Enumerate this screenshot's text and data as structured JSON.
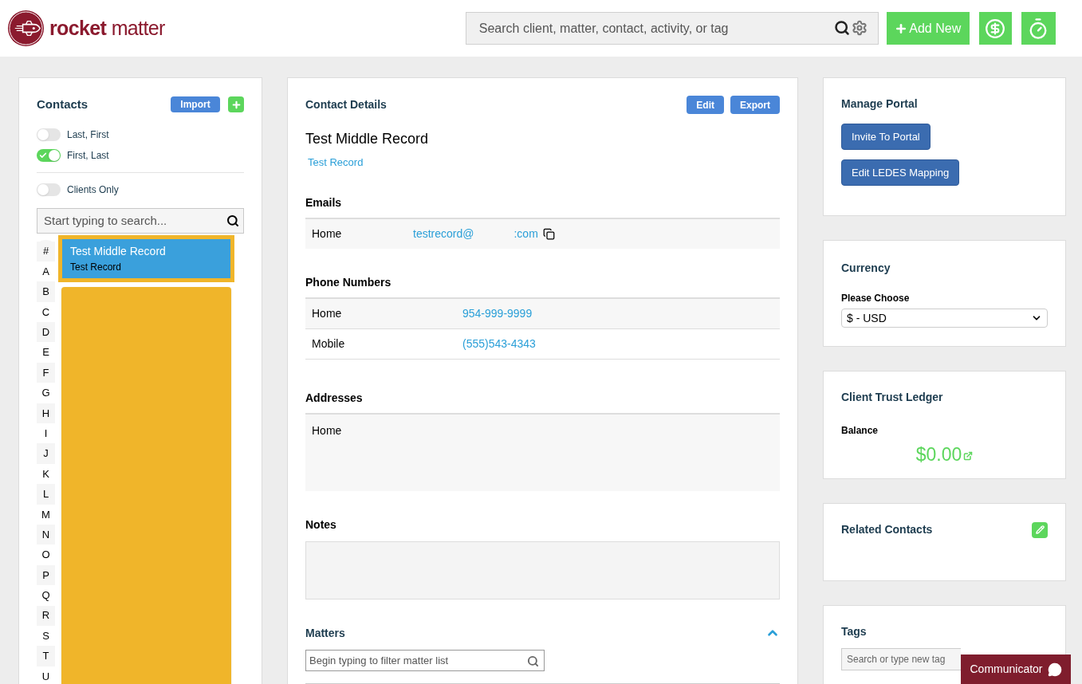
{
  "header": {
    "logo": {
      "bold": "rocket",
      "light": "matter"
    },
    "search": {
      "placeholder": "Search client, matter, contact, activity, or tag"
    },
    "add_button": "Add New"
  },
  "contacts": {
    "title": "Contacts",
    "import_button": "Import",
    "toggles": [
      {
        "label": "Last, First",
        "on": false
      },
      {
        "label": "First, Last",
        "on": true
      }
    ],
    "clients_only": {
      "label": "Clients Only",
      "on": false
    },
    "search": {
      "placeholder": "Start typing to search..."
    },
    "letters": [
      "#",
      "A",
      "B",
      "C",
      "D",
      "E",
      "F",
      "G",
      "H",
      "I",
      "J",
      "K",
      "L",
      "M",
      "N",
      "O",
      "P",
      "Q",
      "R",
      "S",
      "T",
      "U"
    ],
    "items": [
      {
        "name": "Test Middle Record",
        "sub": "Test Record",
        "selected": true
      }
    ]
  },
  "details": {
    "title": "Contact Details",
    "buttons": [
      "Edit",
      "Export"
    ],
    "name": "Test Middle Record",
    "link": "Test Record",
    "emails": {
      "title": "Emails",
      "rows": [
        {
          "label": "Home",
          "start": "testrecord@",
          "end": ":com"
        }
      ]
    },
    "phones": {
      "title": "Phone Numbers",
      "rows": [
        {
          "label": "Home",
          "value": "954-999-9999"
        },
        {
          "label": "Mobile",
          "value": "(555)543-4343"
        }
      ]
    },
    "addresses": {
      "title": "Addresses",
      "rows": [
        {
          "label": "Home"
        }
      ]
    },
    "notes": {
      "title": "Notes"
    },
    "matters": {
      "title": "Matters",
      "expanded": true,
      "filter": {
        "placeholder": "Begin typing to filter matter list"
      }
    }
  },
  "portal": {
    "title": "Manage Portal",
    "buttons": [
      "Invite To Portal",
      "Edit LEDES Mapping"
    ]
  },
  "currency": {
    "title": "Currency",
    "label": "Please Choose",
    "value": "$ - USD"
  },
  "trust": {
    "title": "Client Trust Ledger",
    "label": "Balance",
    "amount": "$0.00"
  },
  "related": {
    "title": "Related Contacts"
  },
  "tags": {
    "title": "Tags",
    "placeholder": "Search or type new tag"
  },
  "communicator": "Communicator"
}
